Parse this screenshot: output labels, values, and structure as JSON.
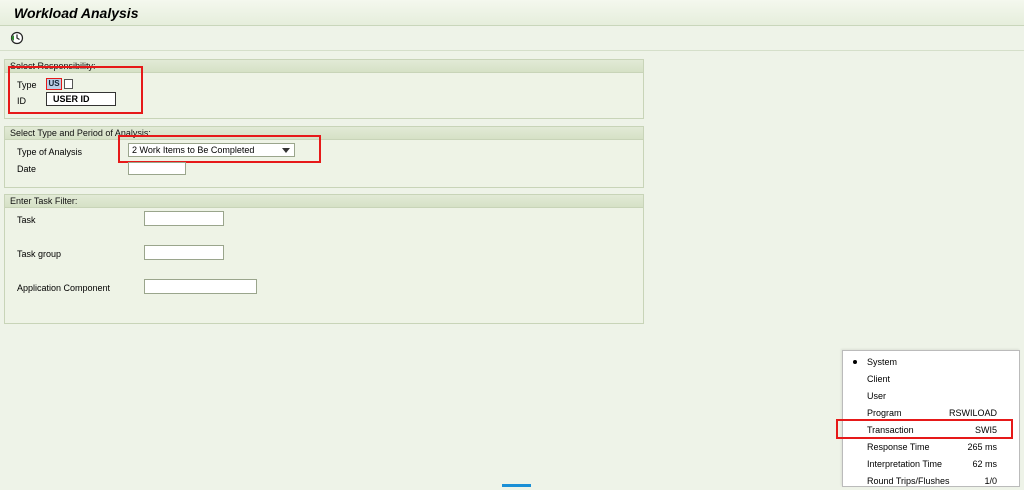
{
  "window": {
    "title": "Workload Analysis"
  },
  "toolbar": {
    "execute_icon": "execute-clock-icon"
  },
  "responsibility": {
    "header": "Select Responsibility:",
    "type_label": "Type",
    "type_value": "US",
    "id_label": "ID",
    "id_value": "USER ID"
  },
  "analysis": {
    "header": "Select Type and Period of Analysis:",
    "type_label": "Type of Analysis",
    "type_value": "2 Work Items to Be Completed",
    "date_label": "Date",
    "date_value": ""
  },
  "task_filter": {
    "header": "Enter Task Filter:",
    "task_label": "Task",
    "task_value": "",
    "task_group_label": "Task group",
    "task_group_value": "",
    "app_component_label": "Application Component",
    "app_component_value": ""
  },
  "status_popup": {
    "items": [
      {
        "label": "System",
        "value": ""
      },
      {
        "label": "Client",
        "value": ""
      },
      {
        "label": "User",
        "value": ""
      },
      {
        "label": "Program",
        "value": "RSWILOAD"
      },
      {
        "label": "Transaction",
        "value": "SWI5"
      },
      {
        "label": "Response Time",
        "value": "265 ms"
      },
      {
        "label": "Interpretation Time",
        "value": "62 ms"
      },
      {
        "label": "Round Trips/Flushes",
        "value": "1/0"
      }
    ]
  },
  "colors": {
    "highlight": "#e61919",
    "background": "#eef3e8",
    "group_header": "#d6e1c6"
  }
}
